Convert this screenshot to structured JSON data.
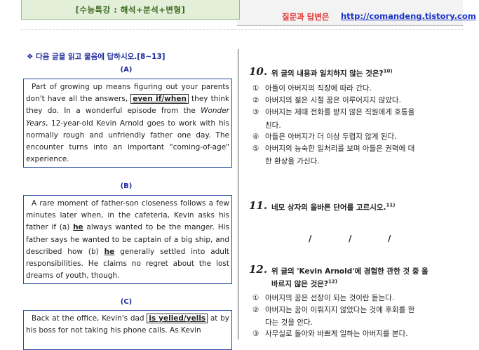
{
  "header": {
    "title": "[수능특강 : 해석+분석+변형]",
    "qa_label": "질문과 답변은",
    "url": "http://comandeng.tistory.com"
  },
  "instruction": "❖ 다음 글을 읽고 물음에 답하시오.[8~13]",
  "passages": {
    "a": {
      "label": "(A)",
      "t1": "Part of growing up means figuring out your parents don't have all the answers, ",
      "boxed": "even if/when",
      "t2": " they think they do. In a wonderful episode from the ",
      "italic": "Wonder Years",
      "t3": ", 12-year-old Kevin Arnold goes to work with his normally rough and unfriendly father one day. The encounter turns into an important \"coming-of-age\" experience."
    },
    "b": {
      "label": "(B)",
      "t1": "A rare moment of father-son closeness follows a few minutes later when, in the cafeteria, Kevin asks his father if (a) ",
      "he1": "he",
      "t2": " always wanted to be the manger. His father says he wanted to be captain of a big ship, and described how (b) ",
      "he2": "he",
      "t3": " generally settled into adult responsibilities. He claims no regret about the lost dreams of youth, though."
    },
    "c": {
      "label": "(C)",
      "t1": "Back at the office, Kevin's dad ",
      "boxed": "is yelled/yells",
      "t2": " at by his boss for not taking his phone calls. As Kevin"
    }
  },
  "q10": {
    "num": "10.",
    "text": "위 글의 내용과 일치하지 않는 것은?",
    "fn": "10)",
    "options": [
      {
        "n": "①",
        "t": "아들이 아버지의 직장에 따라 간다."
      },
      {
        "n": "②",
        "t": "아버지의 젊은 시절 꿈은 이루어지지 않았다."
      },
      {
        "n": "③",
        "t": "아버지는 제때 전화를 받지 않은 직원에게 호통을"
      },
      {
        "n": "④",
        "t": "아들은 아버지가 더 이상 두렵지 않게 된다."
      },
      {
        "n": "⑤",
        "t": "아버지의 능숙한 일처리를 보며 아들은 권력에 대"
      }
    ],
    "cont3": "친다.",
    "cont5": "한 환상을 가신다."
  },
  "q11": {
    "num": "11.",
    "text": "네모 상자의 올바른 단어를 고르시오.",
    "fn": "11)",
    "slash": "/"
  },
  "q12": {
    "num": "12.",
    "text": "위 글의 'Kevin Arnold'에 경험한 관한 것 중 올",
    "text2": "바르지 않은 것은?",
    "fn": "12)",
    "options": [
      {
        "n": "①",
        "t": "아버지의 꿈은 선장이 되는 것이란 듣는다."
      },
      {
        "n": "②",
        "t": "아버지는 꿈이 이뤄지지 않았다는 것에 후회를 한"
      },
      {
        "n": "③",
        "t": "사무실로 돌아와 바쁘게 일하는 아버지를 본다."
      }
    ],
    "cont2": "다는 것을 안다."
  }
}
